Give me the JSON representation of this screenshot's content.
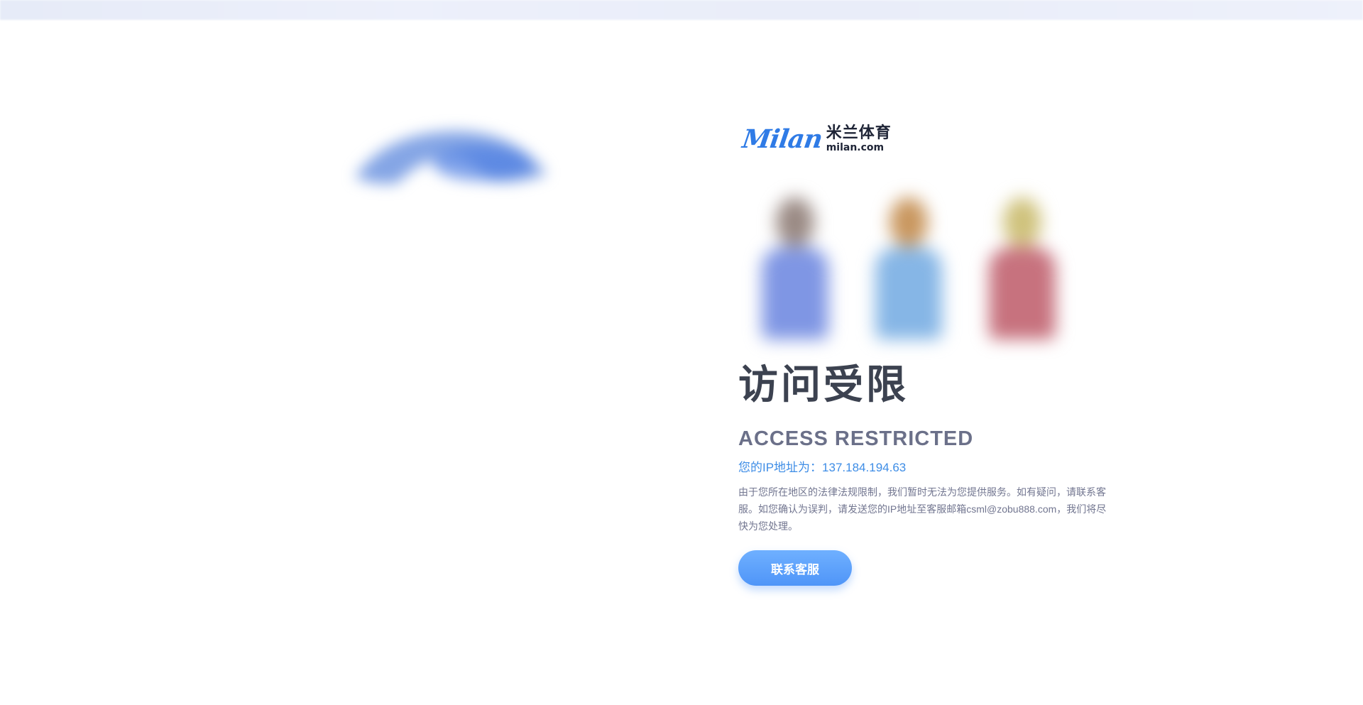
{
  "logo": {
    "mark": "Milan",
    "name_cn": "米兰体育",
    "domain": "milan.com"
  },
  "players": [
    {
      "head_color": "#9a8a84",
      "shirt_color": "#7f96e4"
    },
    {
      "head_color": "#c9975f",
      "shirt_color": "#86b6e6"
    },
    {
      "head_color": "#cfc27c",
      "shirt_color": "#c7727e"
    }
  ],
  "main": {
    "title_cn": "访问受限",
    "title_en": "ACCESS RESTRICTED",
    "ip_text": "您的IP地址为：137.184.194.63",
    "description": "由于您所在地区的法律法规限制，我们暂时无法为您提供服务。如有疑问，请联系客服。如您确认为误判，请发送您的IP地址至客服邮箱csml@zobu888.com，我们将尽快为您处理。",
    "contact_button": "联系客服"
  },
  "colors": {
    "accent": "#3e8de6",
    "button": "#5aa0fb",
    "title": "#3c4250",
    "subtitle": "#6b7089"
  }
}
